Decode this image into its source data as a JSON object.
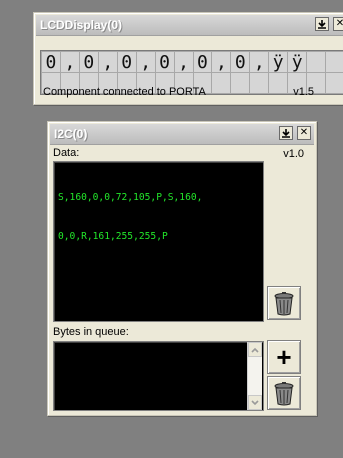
{
  "lcd_window": {
    "title": "LCDDisplay(0)",
    "row1": [
      "0",
      ",",
      "0",
      ",",
      "0",
      ",",
      "0",
      ",",
      "0",
      ",",
      "0",
      ",",
      "ÿ",
      "ÿ",
      "",
      ""
    ],
    "row2": [
      "",
      "",
      "",
      "",
      "",
      "",
      "",
      "",
      "",
      "",
      "",
      "",
      "",
      "",
      "",
      ""
    ],
    "status": "Component connected to PORTA",
    "version": "v1.5",
    "pin_icon": "pin-arrow-icon",
    "close_label": "✕"
  },
  "i2c_window": {
    "title": "I2C(0)",
    "data_label": "Data:",
    "version": "v1.0",
    "data_line1": "S,160,0,0,72,105,P,S,160,",
    "data_line2": "0,0,R,161,255,255,P",
    "queue_label": "Bytes in queue:",
    "queue_value": "",
    "add_label": "+",
    "close_label": "✕"
  },
  "colors": {
    "terminal_text": "#22e62a",
    "terminal_bg": "#000000",
    "desktop": "#808080"
  }
}
